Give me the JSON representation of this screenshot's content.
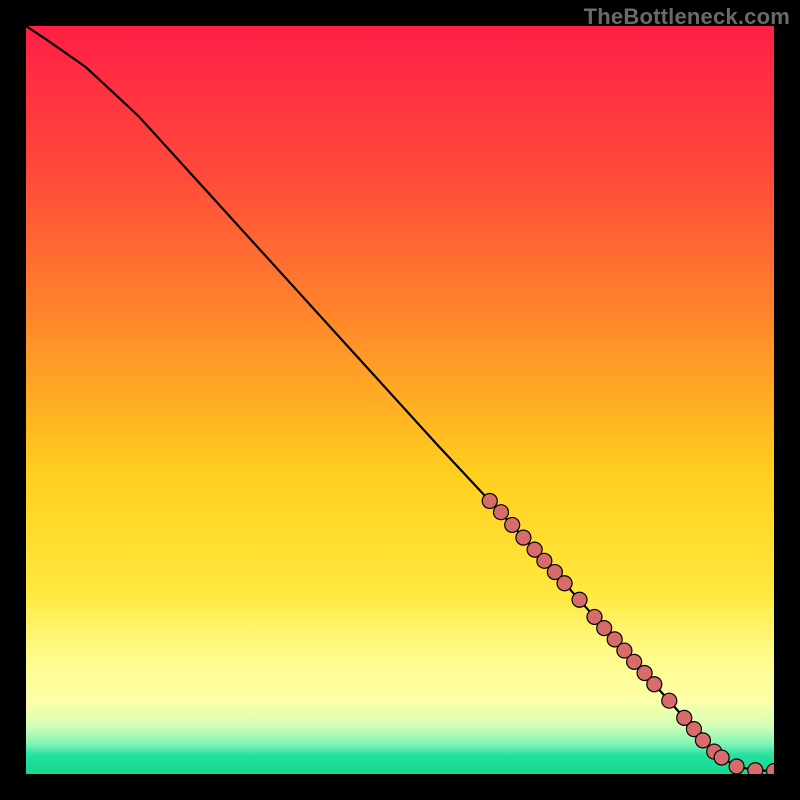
{
  "watermark": "TheBottleneck.com",
  "colors": {
    "gradient_stops": [
      {
        "offset": 0.0,
        "color": "#ff1f46"
      },
      {
        "offset": 0.2,
        "color": "#ff4a3a"
      },
      {
        "offset": 0.4,
        "color": "#ff8a2a"
      },
      {
        "offset": 0.6,
        "color": "#ffcf1e"
      },
      {
        "offset": 0.76,
        "color": "#ffe93e"
      },
      {
        "offset": 0.84,
        "color": "#fffb8a"
      },
      {
        "offset": 0.9,
        "color": "#fdffa6"
      },
      {
        "offset": 0.935,
        "color": "#d6ffb6"
      },
      {
        "offset": 0.96,
        "color": "#7ff5b4"
      },
      {
        "offset": 0.975,
        "color": "#26e0a0"
      },
      {
        "offset": 1.0,
        "color": "#12d98f"
      }
    ],
    "line": "#000000",
    "marker_fill": "#d86c6a",
    "marker_stroke": "#000000"
  },
  "chart_data": {
    "type": "line",
    "title": "",
    "xlabel": "",
    "ylabel": "",
    "xlim": [
      0,
      100
    ],
    "ylim": [
      0,
      100
    ],
    "grid": false,
    "legend": false,
    "series": [
      {
        "name": "curve",
        "x": [
          0,
          3,
          8,
          15,
          25,
          35,
          45,
          55,
          62,
          68,
          72,
          76,
          80,
          84,
          88,
          90.5,
          93,
          95,
          97.5,
          100
        ],
        "y": [
          100,
          98,
          94.5,
          88,
          77,
          66,
          55,
          44,
          36.5,
          30,
          25.5,
          21,
          16.5,
          12,
          7.5,
          4.5,
          2.2,
          1.0,
          0.5,
          0.4
        ]
      }
    ],
    "markers": {
      "name": "highlighted-segment",
      "points": [
        {
          "x": 62.0,
          "y": 36.5
        },
        {
          "x": 63.5,
          "y": 35.0
        },
        {
          "x": 65.0,
          "y": 33.3
        },
        {
          "x": 66.5,
          "y": 31.6
        },
        {
          "x": 68.0,
          "y": 30.0
        },
        {
          "x": 69.3,
          "y": 28.5
        },
        {
          "x": 70.7,
          "y": 27.0
        },
        {
          "x": 72.0,
          "y": 25.5
        },
        {
          "x": 74.0,
          "y": 23.3
        },
        {
          "x": 76.0,
          "y": 21.0
        },
        {
          "x": 77.3,
          "y": 19.5
        },
        {
          "x": 78.7,
          "y": 18.0
        },
        {
          "x": 80.0,
          "y": 16.5
        },
        {
          "x": 81.3,
          "y": 15.0
        },
        {
          "x": 82.7,
          "y": 13.5
        },
        {
          "x": 84.0,
          "y": 12.0
        },
        {
          "x": 86.0,
          "y": 9.8
        },
        {
          "x": 88.0,
          "y": 7.5
        },
        {
          "x": 89.3,
          "y": 6.0
        },
        {
          "x": 90.5,
          "y": 4.5
        },
        {
          "x": 92.0,
          "y": 3.0
        },
        {
          "x": 93.0,
          "y": 2.2
        },
        {
          "x": 95.0,
          "y": 1.0
        },
        {
          "x": 97.5,
          "y": 0.5
        },
        {
          "x": 100.0,
          "y": 0.4
        }
      ]
    }
  }
}
